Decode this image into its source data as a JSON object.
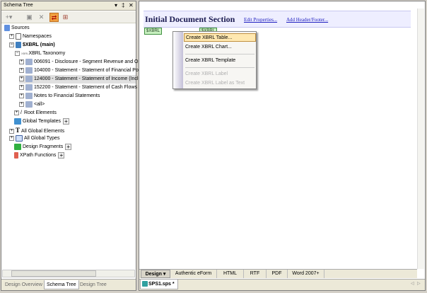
{
  "left_panel": {
    "title": "Schema Tree",
    "title_buttons": [
      "▾",
      "‡",
      "✕"
    ],
    "tree": [
      {
        "label": "Sources"
      },
      {
        "label": "Namespaces"
      },
      {
        "label": "$XBRL (main)"
      },
      {
        "label": "XBRL Taxonomy"
      },
      {
        "label": "006091 - Disclosure - Segment Revenue and Op"
      },
      {
        "label": "104000 - Statement - Statement of Financial Pos"
      },
      {
        "label": "124000 - Statement - Statement of Income (Inclu"
      },
      {
        "label": "152200 - Statement - Statement of Cash Flows"
      },
      {
        "label": "Notes to Financial Statements"
      },
      {
        "label": "<all>"
      },
      {
        "label": "Root Elements"
      },
      {
        "label": "Global Templates"
      },
      {
        "label": "All Global Elements"
      },
      {
        "label": "All Global Types"
      },
      {
        "label": "Design Fragments"
      },
      {
        "label": "XPath Functions"
      }
    ],
    "bottom_tabs": [
      "Design Overview",
      "Schema Tree",
      "Design Tree"
    ],
    "active_tab": "Schema Tree"
  },
  "editor": {
    "section_title": "Initial Document Section",
    "edit_properties": "Edit Properties...",
    "add_header_footer": "Add Header/Footer...",
    "tag_open": "$XBRL",
    "tag_close": "$XBRL",
    "context_menu": [
      {
        "label": "Create XBRL Table...",
        "state": "selected"
      },
      {
        "label": "Create XBRL Chart...",
        "state": "enabled"
      },
      {
        "label": "Create XBRL Template",
        "state": "enabled"
      },
      {
        "label": "Create XBRL Label",
        "state": "disabled"
      },
      {
        "label": "Create XBRL Label as Text",
        "state": "disabled"
      }
    ],
    "view_tabs": [
      "Design ▾",
      "Authentic eForm",
      "HTML",
      "RTF",
      "PDF",
      "Word 2007+"
    ],
    "document_tab": "SPS1.sps *"
  }
}
